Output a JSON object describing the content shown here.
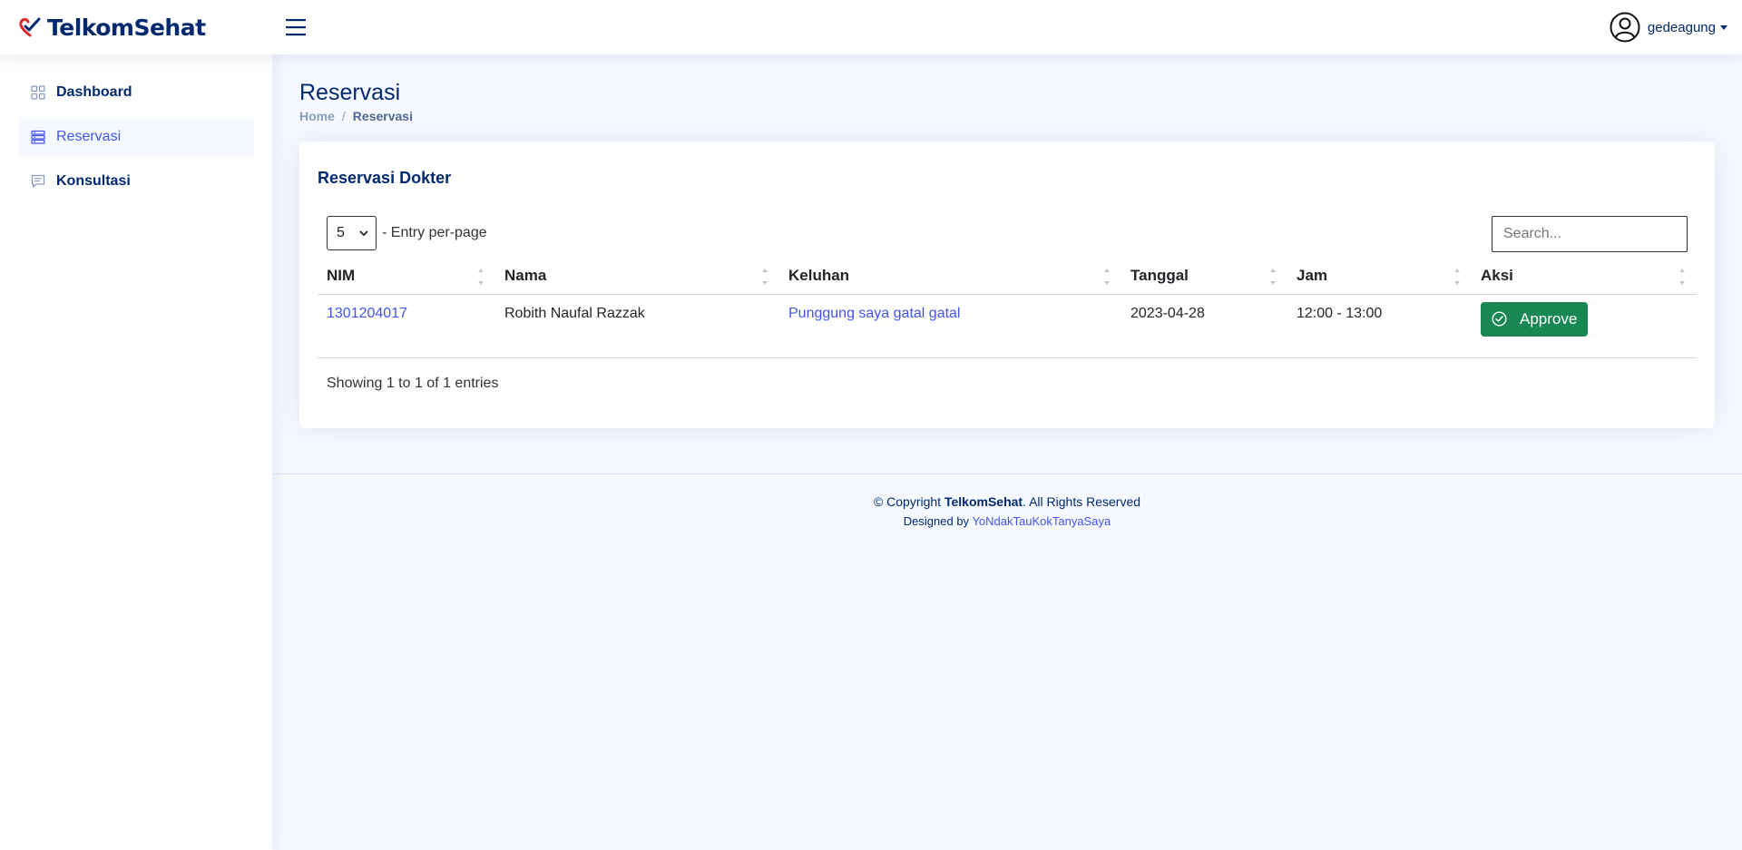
{
  "header": {
    "brand": "TelkomSehat",
    "username": "gedeagung"
  },
  "sidebar": {
    "items": [
      {
        "label": "Dashboard",
        "icon": "grid-icon",
        "active": false
      },
      {
        "label": "Reservasi",
        "icon": "list-icon",
        "active": true
      },
      {
        "label": "Konsultasi",
        "icon": "chat-icon",
        "active": false
      }
    ]
  },
  "page": {
    "title": "Reservasi",
    "breadcrumb": {
      "home": "Home",
      "sep": "/",
      "current": "Reservasi"
    }
  },
  "card": {
    "title": "Reservasi Dokter",
    "per_page_value": "5",
    "per_page_label": "- Entry per-page",
    "search_placeholder": "Search...",
    "columns": [
      "NIM",
      "Nama",
      "Keluhan",
      "Tanggal",
      "Jam",
      "Aksi"
    ],
    "rows": [
      {
        "nim": "1301204017",
        "nama": "Robith Naufal Razzak",
        "keluhan": "Punggung saya gatal gatal",
        "tanggal": "2023-04-28",
        "jam": "12:00 - 13:00",
        "action": "Approve"
      }
    ],
    "info": "Showing 1 to 1 of 1 entries"
  },
  "footer": {
    "copyright_prefix": "© Copyright",
    "copyright_brand": "TelkomSehat",
    "copyright_suffix": ". All Rights Reserved",
    "designed_by": "Designed by",
    "designer": "YoNdakTauKokTanyaSaya"
  },
  "colors": {
    "primary": "#012970",
    "accent": "#4154f1",
    "success": "#198754",
    "background": "#f6f9ff"
  }
}
